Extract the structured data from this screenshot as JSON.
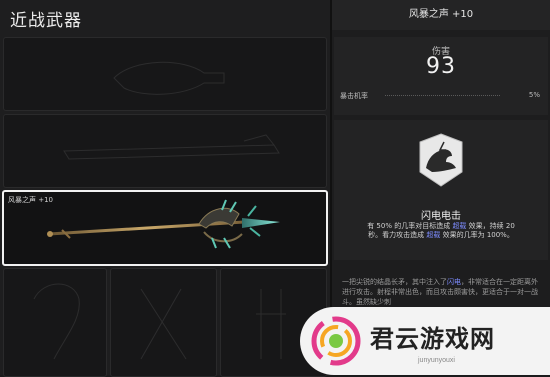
{
  "screen": {
    "title": "近战武器"
  },
  "slots": [
    {
      "id": "slot-1",
      "label": ""
    },
    {
      "id": "slot-2",
      "label": ""
    },
    {
      "id": "slot-3",
      "label": "风暴之声 +10",
      "selected": true
    },
    {
      "id": "slot-4",
      "label": ""
    },
    {
      "id": "slot-5",
      "label": ""
    },
    {
      "id": "slot-6",
      "label": ""
    }
  ],
  "details": {
    "weapon_name": "风暴之声 +10",
    "damage_label": "伤害",
    "damage_value": "93",
    "crit_label": "暴击机率",
    "crit_value": "5%",
    "perk": {
      "icon": "lightning-hand-icon",
      "name": "闪电电击",
      "desc_1": "有 50% 的几率对目标造成 ",
      "desc_hl_1": "超载",
      "desc_2": " 效果，持续 20 秒。看力攻击造成 ",
      "desc_hl_2": "超载",
      "desc_3": " 效果的几率为 100%。"
    },
    "lore_1": "一把尖锐的结晶长矛，其中注入了",
    "lore_hl": "闪电",
    "lore_2": "，非常适合在一定距离外进行攻击。射程非常出色，而且攻击颇害快，更适合于一对一战斗。虽然缺少刺"
  },
  "watermark": {
    "brand": "君云游戏网",
    "domain": "junyunyouxi"
  },
  "colors": {
    "accent_link": "#7d8cff",
    "panel": "#232324",
    "selected_border": "#f2f2f2"
  }
}
